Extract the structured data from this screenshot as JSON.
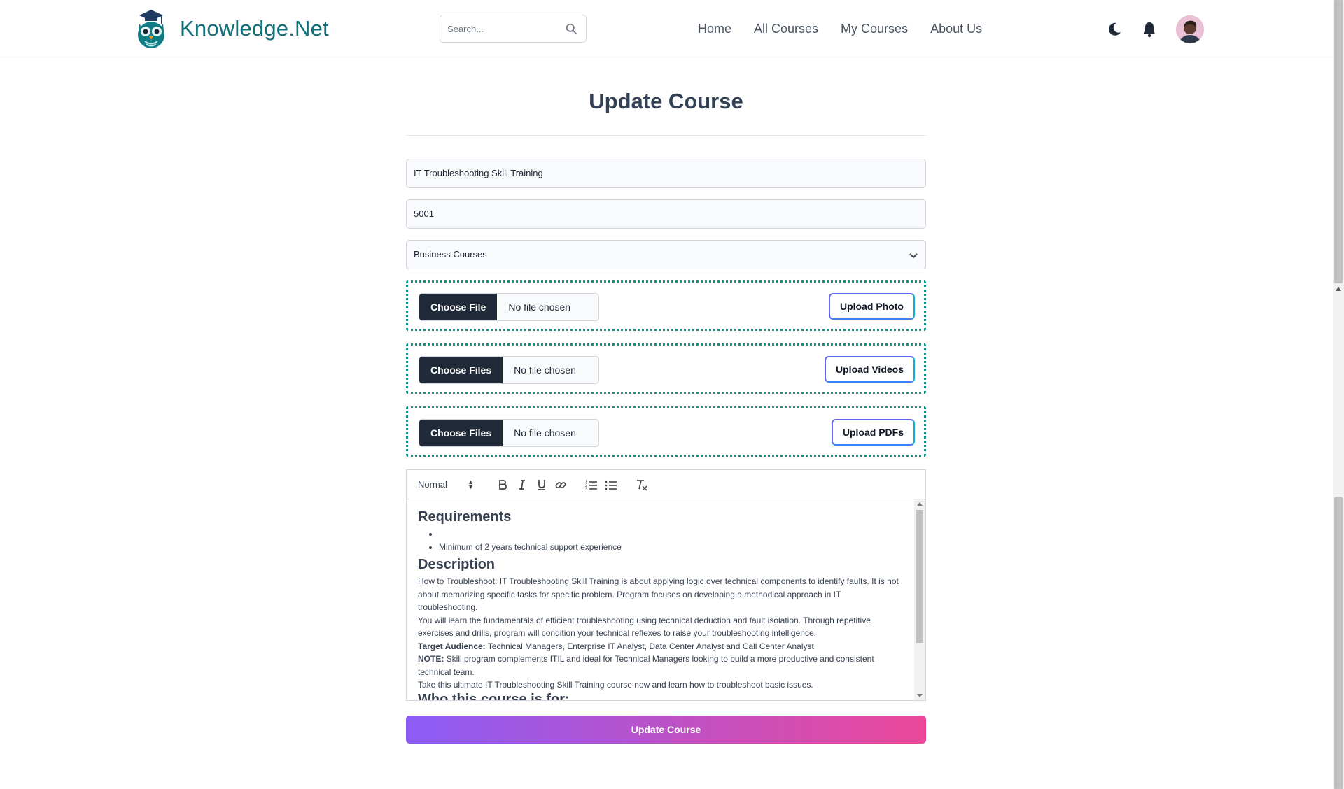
{
  "header": {
    "brand_name": "Knowledge.Net",
    "search_placeholder": "Search...",
    "nav": [
      "Home",
      "All Courses",
      "My Courses",
      "About Us"
    ],
    "icons": [
      "owl-logo-icon",
      "search-icon",
      "moon-icon",
      "bell-icon",
      "avatar"
    ]
  },
  "form": {
    "title": "Update Course",
    "course_name": "IT Troubleshooting Skill Training",
    "course_price": "5001",
    "category_selected": "Business Courses",
    "uploads": [
      {
        "choose_label": "Choose File",
        "status": "No file chosen",
        "upload_label": "Upload Photo"
      },
      {
        "choose_label": "Choose Files",
        "status": "No file chosen",
        "upload_label": "Upload Videos"
      },
      {
        "choose_label": "Choose Files",
        "status": "No file chosen",
        "upload_label": "Upload PDFs"
      }
    ],
    "editor": {
      "format_select": "Normal",
      "requirements_heading": "Requirements",
      "requirements_items": [
        "",
        "Minimum of 2 years technical support experience"
      ],
      "description_heading": "Description",
      "description_paragraphs": [
        "How to Troubleshoot: IT Troubleshooting Skill Training is about applying logic over technical components to identify faults. It is not about memorizing specific tasks for specific problem. Program focuses on developing a methodical approach in IT troubleshooting.",
        "You will learn the fundamentals of efficient troubleshooting using technical deduction and fault isolation. Through repetitive exercises and drills, program will condition your technical reflexes to raise your troubleshooting intelligence."
      ],
      "target_label": "Target Audience:",
      "target_text": " Technical Managers, Enterprise IT Analyst, Data Center Analyst and Call Center Analyst",
      "note_label": "NOTE:",
      "note_text": " Skill program complements ITIL and ideal for Technical Managers looking to build a more productive and consistent technical team.",
      "closing_paragraph": "Take this ultimate IT Troubleshooting Skill Training course now and learn how to troubleshoot basic issues.",
      "who_heading": "Who this course is for:"
    },
    "submit_label": "Update Course"
  },
  "colors": {
    "brand": "#0f6f78",
    "upload_border": "#0d9488",
    "gradient_start": "#8b5cf6",
    "gradient_end": "#ec4899"
  }
}
